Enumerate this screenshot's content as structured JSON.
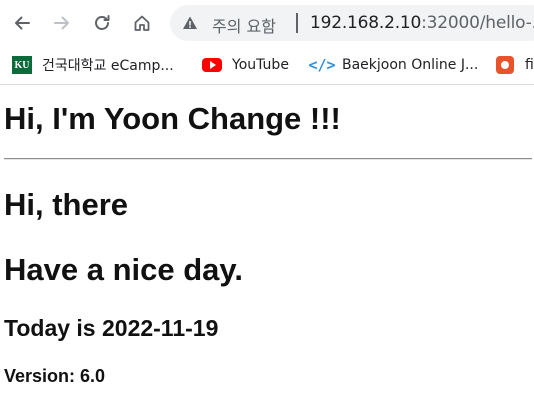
{
  "browser": {
    "security_warning": "주의 요함",
    "url_host": "192.168.2.10",
    "url_rest": ":32000/hello-...",
    "icons": {
      "back": "back-arrow-icon",
      "forward": "forward-arrow-icon",
      "reload": "reload-icon",
      "home": "home-icon",
      "warning": "warning-triangle-icon"
    }
  },
  "bookmarks": [
    {
      "label": "건국대학교 eCamp...",
      "icon": "KU"
    },
    {
      "label": "YouTube",
      "icon": "youtube-icon"
    },
    {
      "label": "Baekjoon Online J...",
      "icon": "</>"
    },
    {
      "label": "fi",
      "icon": "app-icon"
    }
  ],
  "page": {
    "heading1": "Hi, I'm Yoon Change !!!",
    "heading2a": "Hi, there",
    "heading2b": "Have a nice day.",
    "heading3": "Today is 2022-11-19",
    "heading4": "Version: 6.0"
  }
}
